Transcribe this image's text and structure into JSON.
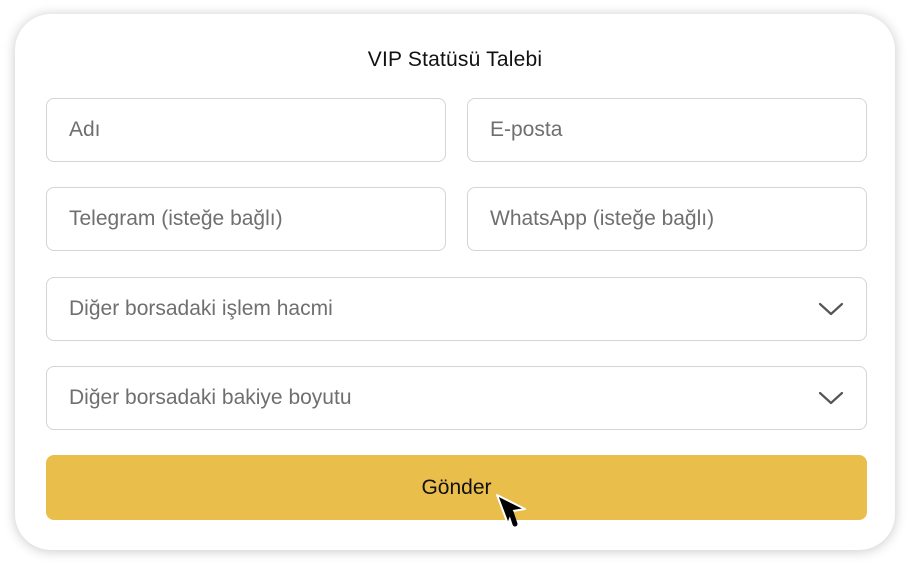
{
  "form": {
    "title": "VIP Statüsü Talebi",
    "fields": {
      "name_placeholder": "Adı",
      "email_placeholder": "E-posta",
      "telegram_placeholder": "Telegram (isteğe bağlı)",
      "whatsapp_placeholder": "WhatsApp (isteğe bağlı)",
      "volume_select": "Diğer borsadaki işlem hacmi",
      "balance_select": "Diğer borsadaki bakiye boyutu"
    },
    "submit_label": "Gönder"
  },
  "colors": {
    "accent": "#eabe4a",
    "border": "#d4d4d4",
    "placeholder": "#6f6f6f",
    "text": "#111111"
  },
  "icons": {
    "select_arrow": "chevron-down-icon",
    "pointer": "mouse-cursor-icon"
  }
}
